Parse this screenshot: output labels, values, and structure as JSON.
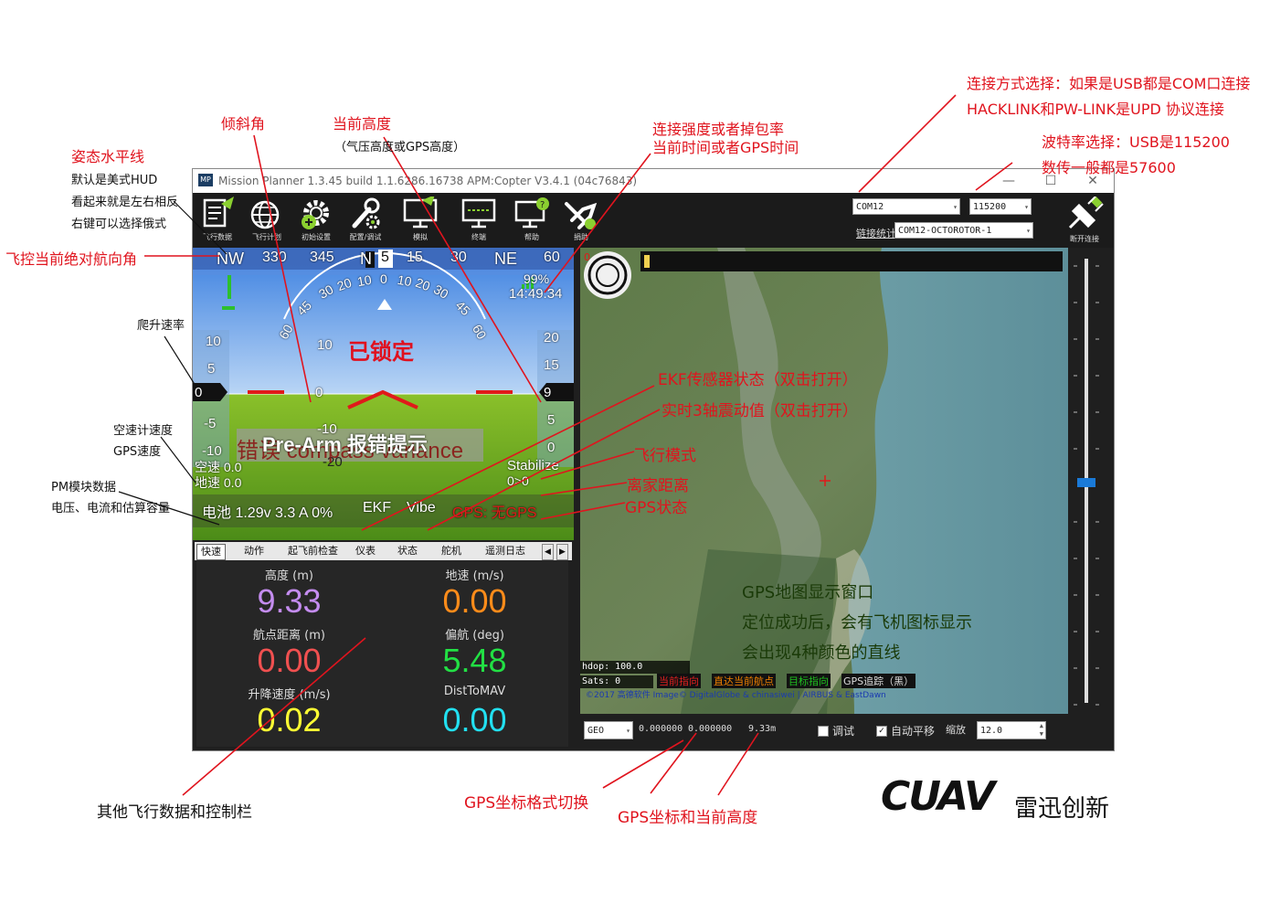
{
  "window": {
    "title": "Mission Planner 1.3.45 build 1.1.6286.16738 APM:Copter V3.4.1 (04c76843)",
    "logo": "MP",
    "min": "—",
    "max": "☐",
    "close": "✕"
  },
  "toolbar": {
    "items": [
      {
        "icon": "flight-data-icon",
        "label": "飞行数据"
      },
      {
        "icon": "flight-plan-icon",
        "label": "飞行计划"
      },
      {
        "icon": "initial-setup-icon",
        "label": "初始设置"
      },
      {
        "icon": "config-tuning-icon",
        "label": "配置/调试"
      },
      {
        "icon": "simulation-icon",
        "label": "模拟"
      },
      {
        "icon": "terminal-icon",
        "label": "终端"
      },
      {
        "icon": "help-icon",
        "label": "帮助"
      },
      {
        "icon": "donate-icon",
        "label": "捐助"
      }
    ],
    "port": "COM12",
    "baud": "115200",
    "link_stats": "链接统计",
    "link_name": "COM12-OCTOROTOR-1",
    "disconnect": "断开连接"
  },
  "hud": {
    "heading_tape": [
      "NW",
      "330",
      "345",
      "N",
      "15",
      "30",
      "NE",
      "60"
    ],
    "heading_value": "5",
    "roll_scale": [
      "60",
      "45",
      "30",
      "20",
      "10",
      "0",
      "10",
      "20",
      "30",
      "45",
      "60"
    ],
    "pitch_labels": [
      "10",
      "10",
      "0",
      "-10",
      "-20"
    ],
    "armed_status": "已锁定",
    "left_tape": [
      "10",
      "5",
      "-5",
      "-10"
    ],
    "left_value": "0",
    "right_tape": [
      "20",
      "15",
      "5",
      "0"
    ],
    "right_value": "9",
    "link_quality": "99%",
    "time": "14:49:34",
    "airspeed": "空速 0.0",
    "groundspeed": "地速 0.0",
    "prearm_bg": "错误 compass variance",
    "prearm_overlay": "Pre-Arm 报错提示",
    "mode": "Stabilize",
    "home_distance": "0>0",
    "battery": "电池 1.29v 3.3 A 0%",
    "ekf": "EKF",
    "vibe": "Vibe",
    "gps": "GPS: 无GPS"
  },
  "tabs": [
    "快速",
    "动作",
    "起飞前检查",
    "仪表",
    "状态",
    "舵机",
    "遥测日志"
  ],
  "quick": [
    {
      "label": "高度 (m)",
      "value": "9.33",
      "color": "#c48cf0"
    },
    {
      "label": "地速 (m/s)",
      "value": "0.00",
      "color": "#ff8c1a"
    },
    {
      "label": "航点距离 (m)",
      "value": "0.00",
      "color": "#f05050"
    },
    {
      "label": "偏航 (deg)",
      "value": "5.48",
      "color": "#22e044"
    },
    {
      "label": "升降速度 (m/s)",
      "value": "0.02",
      "color": "#ffff33"
    },
    {
      "label": "DistToMAV",
      "value": "0.00",
      "color": "#22e0f0"
    }
  ],
  "map": {
    "hdop": "hdop: 100.0",
    "sats": "Sats: 0",
    "legend": [
      "当前指向",
      "直达当前航点",
      "目标指向",
      "GPS追踪（黑）"
    ],
    "legend_colors": [
      "#e02020",
      "#f08000",
      "#20c020",
      "#111111"
    ],
    "copyright": "©2017 高德软件 Image© DigitalGlobe & chinasiwei | AIRBUS & EastDawn",
    "coord_format": "GEO",
    "lat": "0.000000",
    "lng": "0.000000",
    "alt": "9.33m",
    "debug": "调试",
    "autopan": "自动平移",
    "zoom_label": "缩放",
    "zoom": "12.0"
  },
  "annotations": {
    "attitude": "姿态水平线",
    "attitude_note1": "默认是美式HUD",
    "attitude_note2": "看起来就是左右相反",
    "attitude_note3": "右键可以选择俄式",
    "roll": "倾斜角",
    "altitude": "当前高度",
    "altitude_note": "（气压高度或GPS高度）",
    "link": "连接强度或者掉包率",
    "link2": "当前时间或者GPS时间",
    "connection1": "连接方式选择：如果是USB都是COM口连接",
    "connection2": "HACKLINK和PW-LINK是UPD 协议连接",
    "baud1": "波特率选择：USB是115200",
    "baud2": "数传一般都是57600",
    "heading": "飞控当前绝对航向角",
    "climb": "爬升速率",
    "airspeed": "空速计速度",
    "gpsspeed": "GPS速度",
    "pm1": "PM模块数据",
    "pm2": "电压、电流和估算容量",
    "ekf": "EKF传感器状态（双击打开）",
    "vibe": "实时3轴震动值（双击打开）",
    "mode": "飞行模式",
    "home": "离家距离",
    "gps": "GPS状态",
    "map1": "GPS地图显示窗口",
    "map2": "定位成功后，会有飞机图标显示",
    "map3": "会出现4种颜色的直线",
    "other": "其他飞行数据和控制栏",
    "coordfmt": "GPS坐标格式切换",
    "coord": "GPS坐标和当前高度",
    "brand": "CUAV",
    "brand_cn": "雷迅创新"
  }
}
